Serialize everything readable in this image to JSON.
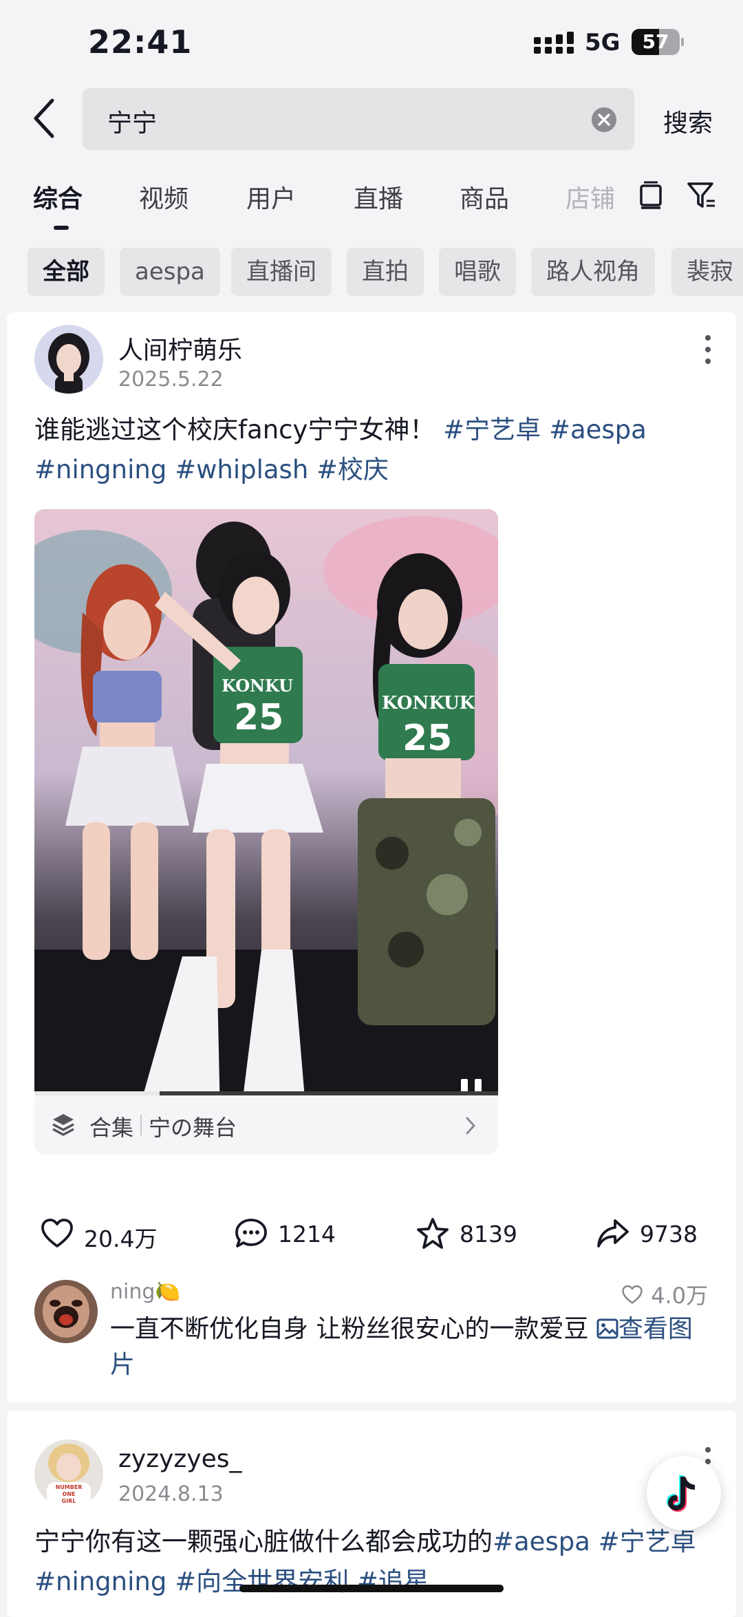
{
  "status_bar": {
    "time": "22:41",
    "network": "5G",
    "battery": "57",
    "battery_level": 0.57
  },
  "search": {
    "query": "宁宁",
    "button": "搜索"
  },
  "tabs": [
    "综合",
    "视频",
    "用户",
    "直播",
    "商品",
    "店铺"
  ],
  "chips": [
    "全部",
    "aespa",
    "直播间",
    "直拍",
    "唱歌",
    "路人视角",
    "裴寂"
  ],
  "post1": {
    "author": "人间柠萌乐",
    "date": "2025.5.22",
    "caption_text": "谁能逃过这个校庆fancy宁宁女神！",
    "tags": [
      "#宁艺卓",
      "#aespa",
      "#ningning",
      "#whiplash",
      "#校庆"
    ],
    "collection_label": "合集",
    "collection_name": "宁の舞台",
    "video_progress": 0.27,
    "actions": {
      "likes": "20.4万",
      "comments": "1214",
      "favorites": "8139",
      "shares": "9738"
    },
    "comment": {
      "user": "ning🍋",
      "likes": "4.0万",
      "text": "一直不断优化自身 让粉丝很安心的一款爱豆",
      "link": "查看图片"
    }
  },
  "post2": {
    "author": "zyzyzyes_",
    "date": "2024.8.13",
    "caption_text": "宁宁你有这一颗强心脏做什么都会成功的",
    "tags": [
      "#aespa",
      "#宁艺卓",
      "#ningning",
      "#向全世界安利",
      "#追星"
    ],
    "avatar_text": [
      "NUMBER",
      "ONE",
      "GIRL"
    ]
  },
  "colors": {
    "tag_blue": "#2b4f80",
    "text": "#161823",
    "muted": "#8a8b91",
    "background": "#f4f4f6"
  }
}
